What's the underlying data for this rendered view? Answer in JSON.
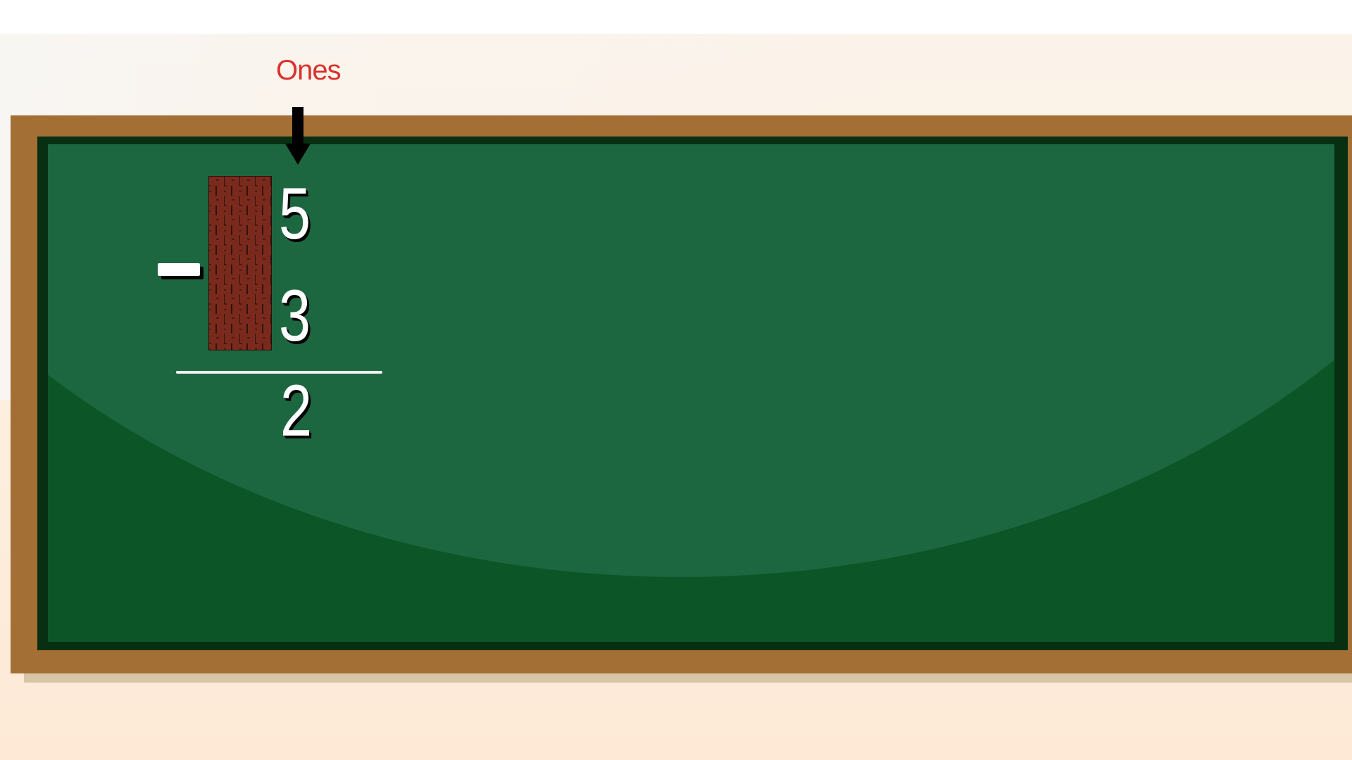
{
  "header": {
    "place_value_label": "Ones"
  },
  "problem": {
    "operator": "-",
    "minuend": "5",
    "subtrahend": "3",
    "difference": "2"
  },
  "colors": {
    "label": "#d9322c",
    "board": "#0c5526",
    "frame": "#a46f35",
    "brick": "#7a2a1d"
  },
  "icons": {
    "arrow": "down-arrow-icon",
    "block": "brick-column-icon"
  }
}
